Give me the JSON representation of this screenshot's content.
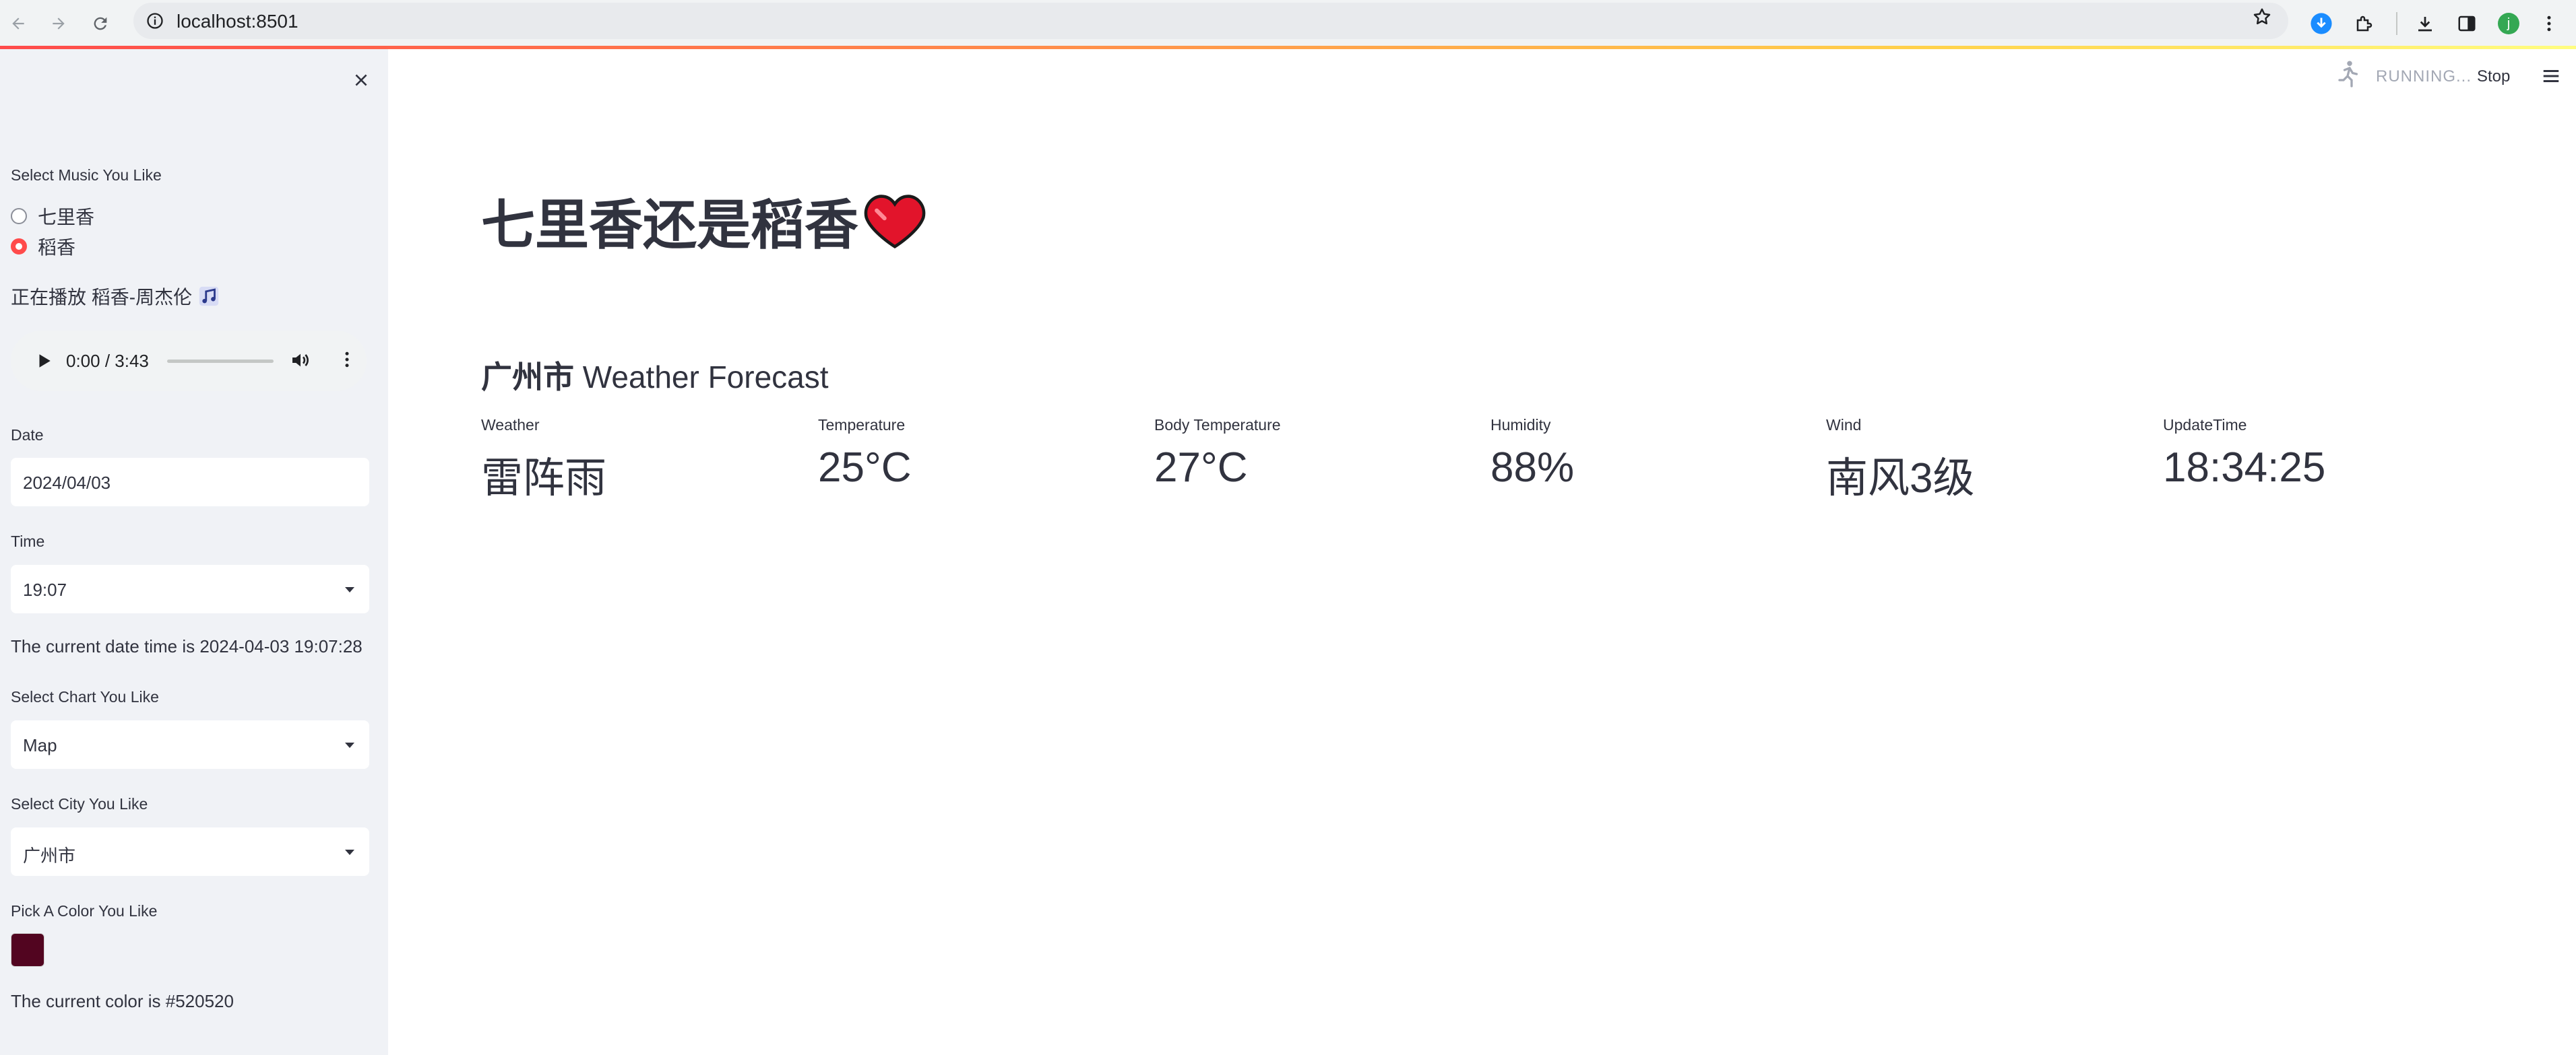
{
  "browser": {
    "url": "localhost:8501",
    "profile_initial": "j"
  },
  "sidebar": {
    "music_label": "Select Music You Like",
    "music_options": [
      "七里香",
      "稻香"
    ],
    "music_selected_index": 1,
    "now_playing_prefix": "正在播放 稻香-周杰伦",
    "now_playing_icon": "music-note-icon",
    "audio": {
      "current": "0:00",
      "duration": "3:43",
      "time_text": "0:00 / 3:43",
      "progress": 0
    },
    "date_label": "Date",
    "date_value": "2024/04/03",
    "time_label": "Time",
    "time_value": "19:07",
    "datetime_text": "The current date time is 2024-04-03 19:07:28",
    "chart_label": "Select Chart You Like",
    "chart_value": "Map",
    "city_label": "Select City You Like",
    "city_value": "广州市",
    "color_label": "Pick A Color You Like",
    "color_value": "#520520",
    "color_text": "The current color is #520520"
  },
  "status": {
    "running_text": "RUNNING...",
    "stop_label": "Stop"
  },
  "main": {
    "title": "七里香还是稻香",
    "title_icon": "heart-icon",
    "forecast_city": "广州市",
    "forecast_suffix": "Weather Forecast",
    "metrics": [
      {
        "label": "Weather",
        "value": "雷阵雨"
      },
      {
        "label": "Temperature",
        "value": "25°C"
      },
      {
        "label": "Body Temperature",
        "value": "27°C"
      },
      {
        "label": "Humidity",
        "value": "88%"
      },
      {
        "label": "Wind",
        "value": "南风3级"
      },
      {
        "label": "UpdateTime",
        "value": "18:34:25"
      }
    ]
  },
  "colors": {
    "accent": "#ff4b4b",
    "sidebar_bg": "#f0f2f6",
    "text": "#31333f"
  }
}
